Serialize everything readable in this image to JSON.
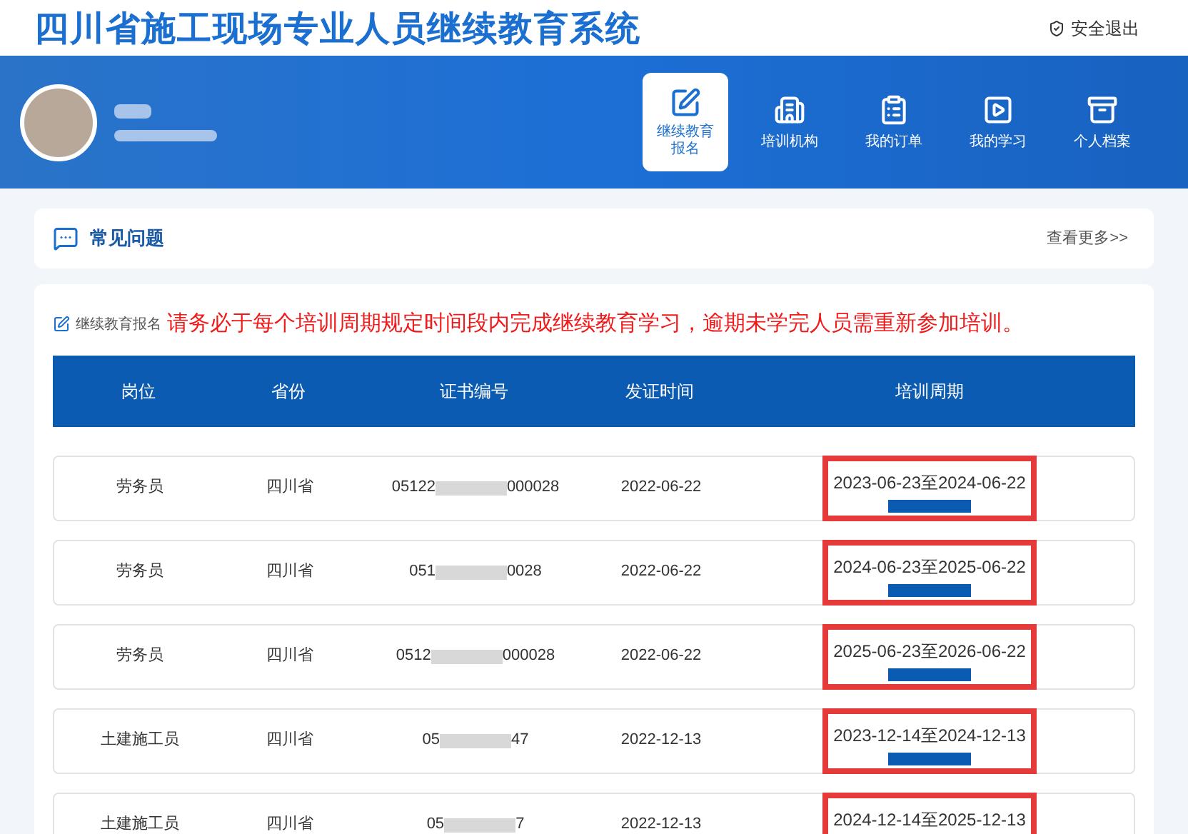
{
  "header": {
    "title": "四川省施工现场专业人员继续教育系统",
    "logout": "安全退出"
  },
  "nav": [
    {
      "label": "继续教育报名",
      "selected": true
    },
    {
      "label": "培训机构",
      "selected": false
    },
    {
      "label": "我的订单",
      "selected": false
    },
    {
      "label": "我的学习",
      "selected": false
    },
    {
      "label": "个人档案",
      "selected": false
    }
  ],
  "faq": {
    "title": "常见问题",
    "more": "查看更多>>"
  },
  "enroll": {
    "label": "继续教育报名",
    "notice": "请务必于每个培训周期规定时间段内完成继续教育学习，逾期未学完人员需重新参加培训。"
  },
  "table": {
    "columns": [
      "岗位",
      "省份",
      "证书编号",
      "发证时间",
      "培训周期"
    ],
    "rows": [
      {
        "position": "劳务员",
        "province": "四川省",
        "cert_start": "05122",
        "cert_end": "000028",
        "issued": "2022-06-22",
        "period": "2023-06-23至2024-06-22",
        "highlighted": true
      },
      {
        "position": "劳务员",
        "province": "四川省",
        "cert_start": "051",
        "cert_end": "0028",
        "issued": "2022-06-22",
        "period": "2024-06-23至2025-06-22",
        "highlighted": true
      },
      {
        "position": "劳务员",
        "province": "四川省",
        "cert_start": "0512",
        "cert_end": "000028",
        "issued": "2022-06-22",
        "period": "2025-06-23至2026-06-22",
        "highlighted": true
      },
      {
        "position": "土建施工员",
        "province": "四川省",
        "cert_start": "05",
        "cert_end": "47",
        "issued": "2022-12-13",
        "period": "2023-12-14至2024-12-13",
        "highlighted": true
      },
      {
        "position": "土建施工员",
        "province": "四川省",
        "cert_start": "05",
        "cert_end": "7",
        "issued": "2022-12-13",
        "period": "2024-12-14至2025-12-13",
        "highlighted": true
      }
    ]
  }
}
